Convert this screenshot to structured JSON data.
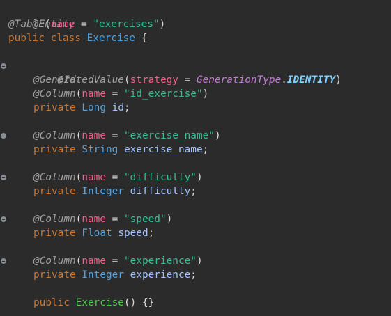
{
  "lines": {
    "l1": {
      "annotation": "@Entity"
    },
    "l2": {
      "annotation": "@Table",
      "open": "(",
      "attr": "name",
      "eq": " = ",
      "value": "\"exercises\"",
      "close": ")"
    },
    "l3": {
      "kw1": "public",
      "kw2": "class",
      "class_name": "Exercise",
      "brace": " {"
    },
    "l4": {
      "annotation": "@Id"
    },
    "l5": {
      "annotation": "@GeneratedValue",
      "open": "(",
      "attr": "strategy",
      "eq": " = ",
      "enum_type": "GenerationType",
      "dot": ".",
      "enum_const": "IDENTITY",
      "close": ")"
    },
    "l6": {
      "annotation": "@Column",
      "open": "(",
      "attr": "name",
      "eq": " = ",
      "value": "\"id_exercise\"",
      "close": ")"
    },
    "l7": {
      "kw": "private",
      "type": "Long",
      "field": "id",
      "semi": ";"
    },
    "l8": {
      "annotation": "@Column",
      "open": "(",
      "attr": "name",
      "eq": " = ",
      "value": "\"exercise_name\"",
      "close": ")"
    },
    "l9": {
      "kw": "private",
      "type": "String",
      "field": "exercise_name",
      "semi": ";"
    },
    "l10": {
      "annotation": "@Column",
      "open": "(",
      "attr": "name",
      "eq": " = ",
      "value": "\"difficulty\"",
      "close": ")"
    },
    "l11": {
      "kw": "private",
      "type": "Integer",
      "field": "difficulty",
      "semi": ";"
    },
    "l12": {
      "annotation": "@Column",
      "open": "(",
      "attr": "name",
      "eq": " = ",
      "value": "\"speed\"",
      "close": ")"
    },
    "l13": {
      "kw": "private",
      "type": "Float",
      "field": "speed",
      "semi": ";"
    },
    "l14": {
      "annotation": "@Column",
      "open": "(",
      "attr": "name",
      "eq": " = ",
      "value": "\"experience\"",
      "close": ")"
    },
    "l15": {
      "kw": "private",
      "type": "Integer",
      "field": "experience",
      "semi": ";"
    },
    "l16": {
      "kw": "public",
      "ctor": "Exercise",
      "rest": "() {}"
    }
  }
}
